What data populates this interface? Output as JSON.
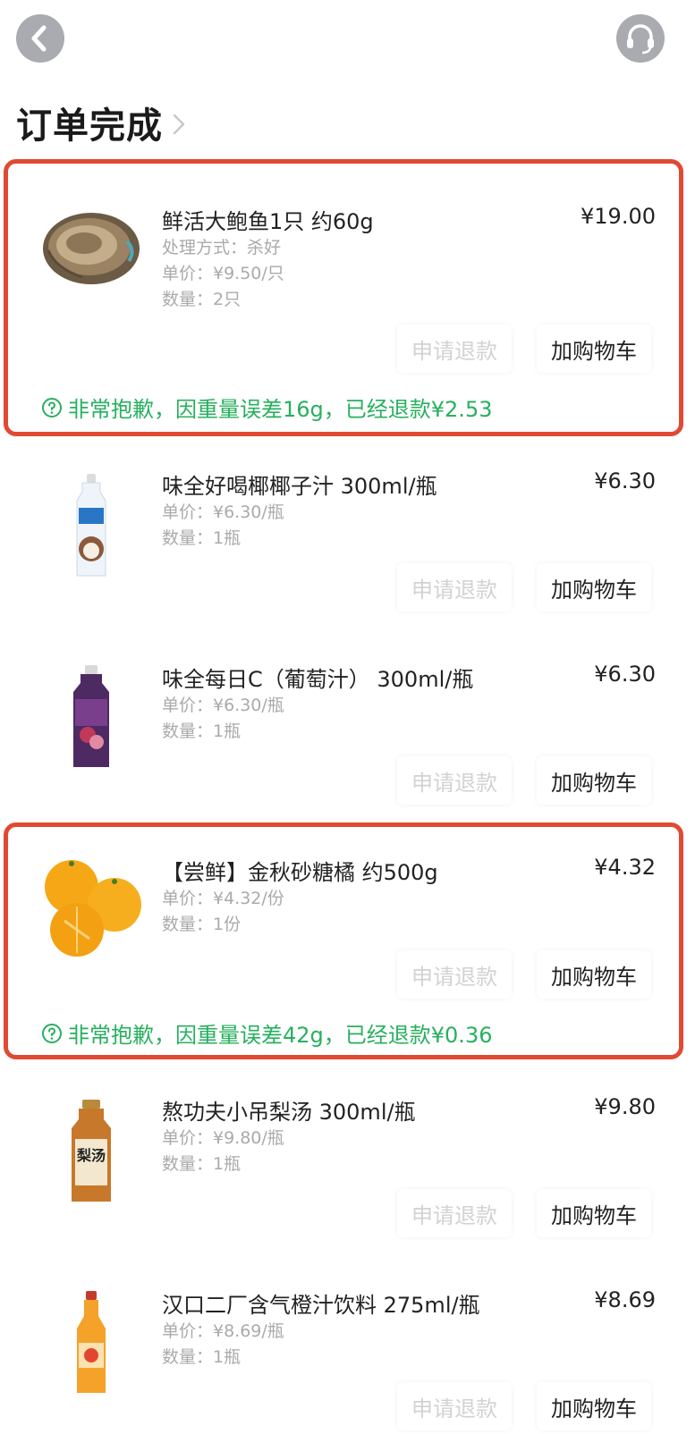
{
  "header": {
    "title": "订单完成",
    "back_icon": "back-arrow-icon",
    "support_icon": "headset-icon"
  },
  "colors": {
    "highlight_border": "#e04a32",
    "note_green": "#27b05e",
    "icon_button_bg": "#a9abb0"
  },
  "items": [
    {
      "name": "鲜活大鲍鱼1只 约60g",
      "process": "处理方式：杀好",
      "unit_price": "单价：¥9.50/只",
      "quantity": "数量：2只",
      "price": "¥19.00",
      "refund_label": "申请退款",
      "cart_label": "加购物车",
      "note": "非常抱歉，因重量误差16g，已经退款¥2.53",
      "image": "abalone"
    },
    {
      "name": "味全好喝椰椰子汁 300ml/瓶",
      "unit_price": "单价：¥6.30/瓶",
      "quantity": "数量：1瓶",
      "price": "¥6.30",
      "refund_label": "申请退款",
      "cart_label": "加购物车",
      "image": "coconut-juice-bottle"
    },
    {
      "name": "味全每日C（葡萄汁） 300ml/瓶",
      "unit_price": "单价：¥6.30/瓶",
      "quantity": "数量：1瓶",
      "price": "¥6.30",
      "refund_label": "申请退款",
      "cart_label": "加购物车",
      "image": "grape-juice-bottle"
    },
    {
      "name": "【尝鲜】金秋砂糖橘 约500g",
      "unit_price": "单价：¥4.32/份",
      "quantity": "数量：1份",
      "price": "¥4.32",
      "refund_label": "申请退款",
      "cart_label": "加购物车",
      "note": "非常抱歉，因重量误差42g，已经退款¥0.36",
      "image": "tangerines"
    },
    {
      "name": "熬功夫小吊梨汤 300ml/瓶",
      "unit_price": "单价：¥9.80/瓶",
      "quantity": "数量：1瓶",
      "price": "¥9.80",
      "refund_label": "申请退款",
      "cart_label": "加购物车",
      "image": "pear-soup-bottle",
      "label_text": "梨汤"
    },
    {
      "name": "汉口二厂含气橙汁饮料 275ml/瓶",
      "unit_price": "单价：¥8.69/瓶",
      "quantity": "数量：1瓶",
      "price": "¥8.69",
      "refund_label": "申请退款",
      "cart_label": "加购物车",
      "image": "orange-soda-bottle"
    }
  ]
}
